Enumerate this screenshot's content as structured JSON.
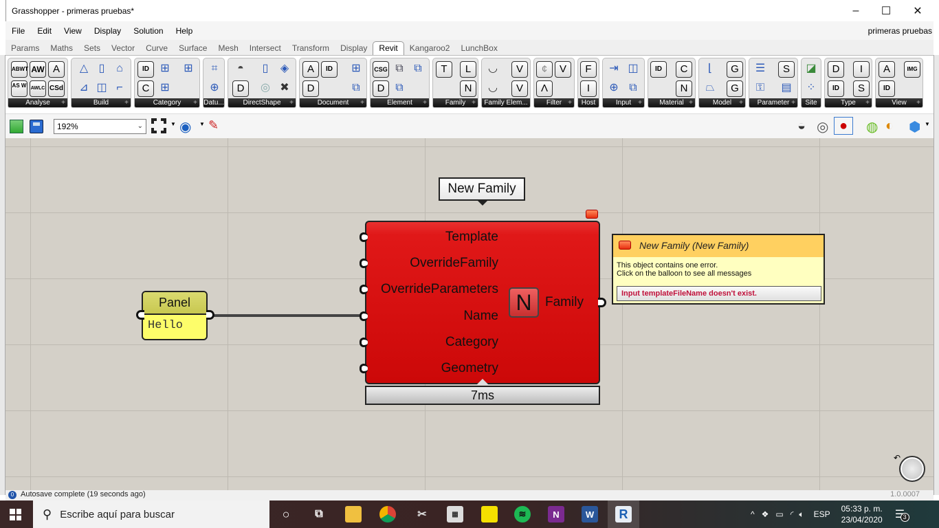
{
  "window": {
    "title": "Grasshopper - primeras pruebas*",
    "controls": {
      "minimize": "–",
      "maximize": "☐",
      "close": "✕"
    }
  },
  "menubar": {
    "items": [
      "File",
      "Edit",
      "View",
      "Display",
      "Solution",
      "Help"
    ],
    "document_name": "primeras pruebas"
  },
  "tabs": [
    "Params",
    "Maths",
    "Sets",
    "Vector",
    "Curve",
    "Surface",
    "Mesh",
    "Intersect",
    "Transform",
    "Display",
    "Revit",
    "Kangaroo2",
    "LunchBox"
  ],
  "active_tab": "Revit",
  "ribbon_groups": [
    {
      "label": "Analyse",
      "icons": [
        "ABWT",
        "AW",
        "A",
        "AS W",
        "AWLC",
        "CSd"
      ]
    },
    {
      "label": "Build",
      "icons": [
        "triangle-points-icon",
        "column-icon",
        "roof-icon",
        "beam-icon",
        "wall-icon",
        "floor-icon"
      ]
    },
    {
      "label": "Category",
      "icons": [
        "ID",
        "C",
        "category-grid-icon",
        "subcategory-icon",
        "category-filter-icon"
      ]
    },
    {
      "label": "Datu...",
      "icons": [
        "grid-icon",
        "level-icon"
      ]
    },
    {
      "label": "DirectShape",
      "icons": [
        "directshape-icon",
        "D",
        "directshape-type-icon",
        "library-icon",
        "delete-icon"
      ]
    },
    {
      "label": "Document",
      "icons": [
        "A",
        "ID",
        "D",
        "filter-icon",
        "element-filter-icon"
      ]
    },
    {
      "label": "Element",
      "icons": [
        "CSG",
        "D",
        "element-icon",
        "element-geometry-icon",
        "element-move-icon"
      ]
    },
    {
      "label": "Family",
      "icons": [
        "T",
        "L",
        "N"
      ]
    },
    {
      "label": "Family Elem...",
      "icons": [
        "form-icon",
        "void-icon",
        "V",
        "V"
      ]
    },
    {
      "label": "Filter",
      "icons": [
        "¢",
        "V",
        "Λ"
      ]
    },
    {
      "label": "Host",
      "icons": [
        "F",
        "I"
      ]
    },
    {
      "label": "Input",
      "icons": [
        "input-param-icon",
        "input-rect-icon",
        "input-point-icon",
        "input-box-icon"
      ]
    },
    {
      "label": "Material",
      "icons": [
        "ID",
        "C",
        "N"
      ]
    },
    {
      "label": "Model",
      "icons": [
        "curve-icon",
        "mesh-icon",
        "G",
        "G"
      ]
    },
    {
      "label": "Parameter",
      "icons": [
        "param-list-icon",
        "param-key-icon",
        "S",
        "param-set-icon"
      ]
    },
    {
      "label": "Site",
      "icons": [
        "topography-icon",
        "survey-icon"
      ]
    },
    {
      "label": "Type",
      "icons": [
        "D",
        "I",
        "ID",
        "S"
      ]
    },
    {
      "label": "View",
      "icons": [
        "A",
        "IMG",
        "ID"
      ]
    }
  ],
  "canvas_toolbar": {
    "zoom": "192%",
    "icons": [
      "open-file-icon",
      "save-icon",
      "zoom-extents-icon",
      "preview-eye-icon",
      "sketch-pen-icon"
    ],
    "right_icons": [
      "preview-off-icon",
      "wireframe-icon",
      "shaded-icon",
      "selected-only-icon",
      "document-preview-icon",
      "preview-mesh-icon"
    ]
  },
  "canvas": {
    "component": {
      "name_balloon": "New Family",
      "inputs": [
        "Template",
        "OverrideFamily",
        "OverrideParameters",
        "Name",
        "Category",
        "Geometry"
      ],
      "icon_letter": "N",
      "output": "Family",
      "timing": "7ms",
      "state_color": "#e01818"
    },
    "panel": {
      "title": "Panel",
      "value": "Hello"
    },
    "error_tooltip": {
      "title": "New Family (New Family)",
      "line1": "This object contains one error.",
      "line2": "Click on the balloon to see all messages",
      "message": "Input templateFileName doesn't exist."
    }
  },
  "statusbar": {
    "text": "Autosave complete (19 seconds ago)",
    "badge": "0",
    "version": "1.0.0007"
  },
  "taskbar": {
    "search_placeholder": "Escribe aquí para buscar",
    "apps": [
      "cortana-icon",
      "task-view-icon",
      "file-explorer-icon",
      "chrome-icon",
      "snip-icon",
      "calculator-icon",
      "sticky-notes-icon",
      "spotify-icon",
      "onenote-icon",
      "word-icon",
      "revit-icon"
    ],
    "language": "ESP",
    "time": "05:33 p. m.",
    "date": "23/04/2020",
    "notifications": "3"
  }
}
